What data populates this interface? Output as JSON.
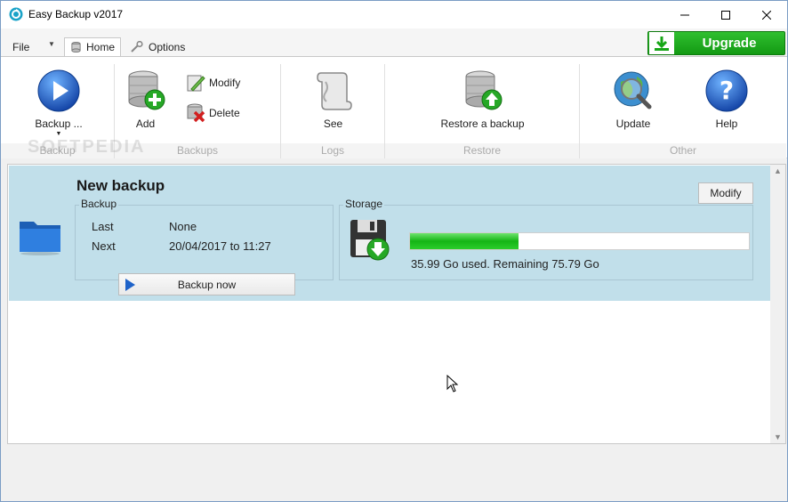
{
  "window": {
    "title": "Easy Backup v2017",
    "controls": [
      "minimize",
      "maximize",
      "close"
    ]
  },
  "tabs": {
    "file": "File",
    "home": "Home",
    "options": "Options"
  },
  "upgrade": {
    "label": "Upgrade"
  },
  "ribbon": {
    "watermark": "SOFTPEDIA",
    "groups": {
      "backup": "Backup",
      "backups": "Backups",
      "logs": "Logs",
      "restore": "Restore",
      "other": "Other"
    },
    "buttons": {
      "backup": "Backup ...",
      "add": "Add",
      "modify": "Modify",
      "delete": "Delete",
      "see": "See",
      "restore": "Restore a backup",
      "update": "Update",
      "help": "Help"
    }
  },
  "backup_item": {
    "title": "New backup",
    "modify_label": "Modify",
    "backup_section": {
      "legend": "Backup",
      "last_label": "Last",
      "last_value": "None",
      "next_label": "Next",
      "next_value": "20/04/2017 to 11:27"
    },
    "backup_now_label": "Backup now",
    "storage_section": {
      "legend": "Storage",
      "used_fraction": 0.32,
      "text": "35.99 Go used. Remaining 75.79 Go"
    }
  },
  "colors": {
    "accent_green": "#15b515",
    "card_bg": "#c1dfea",
    "button_blue": "#1f63c9"
  }
}
